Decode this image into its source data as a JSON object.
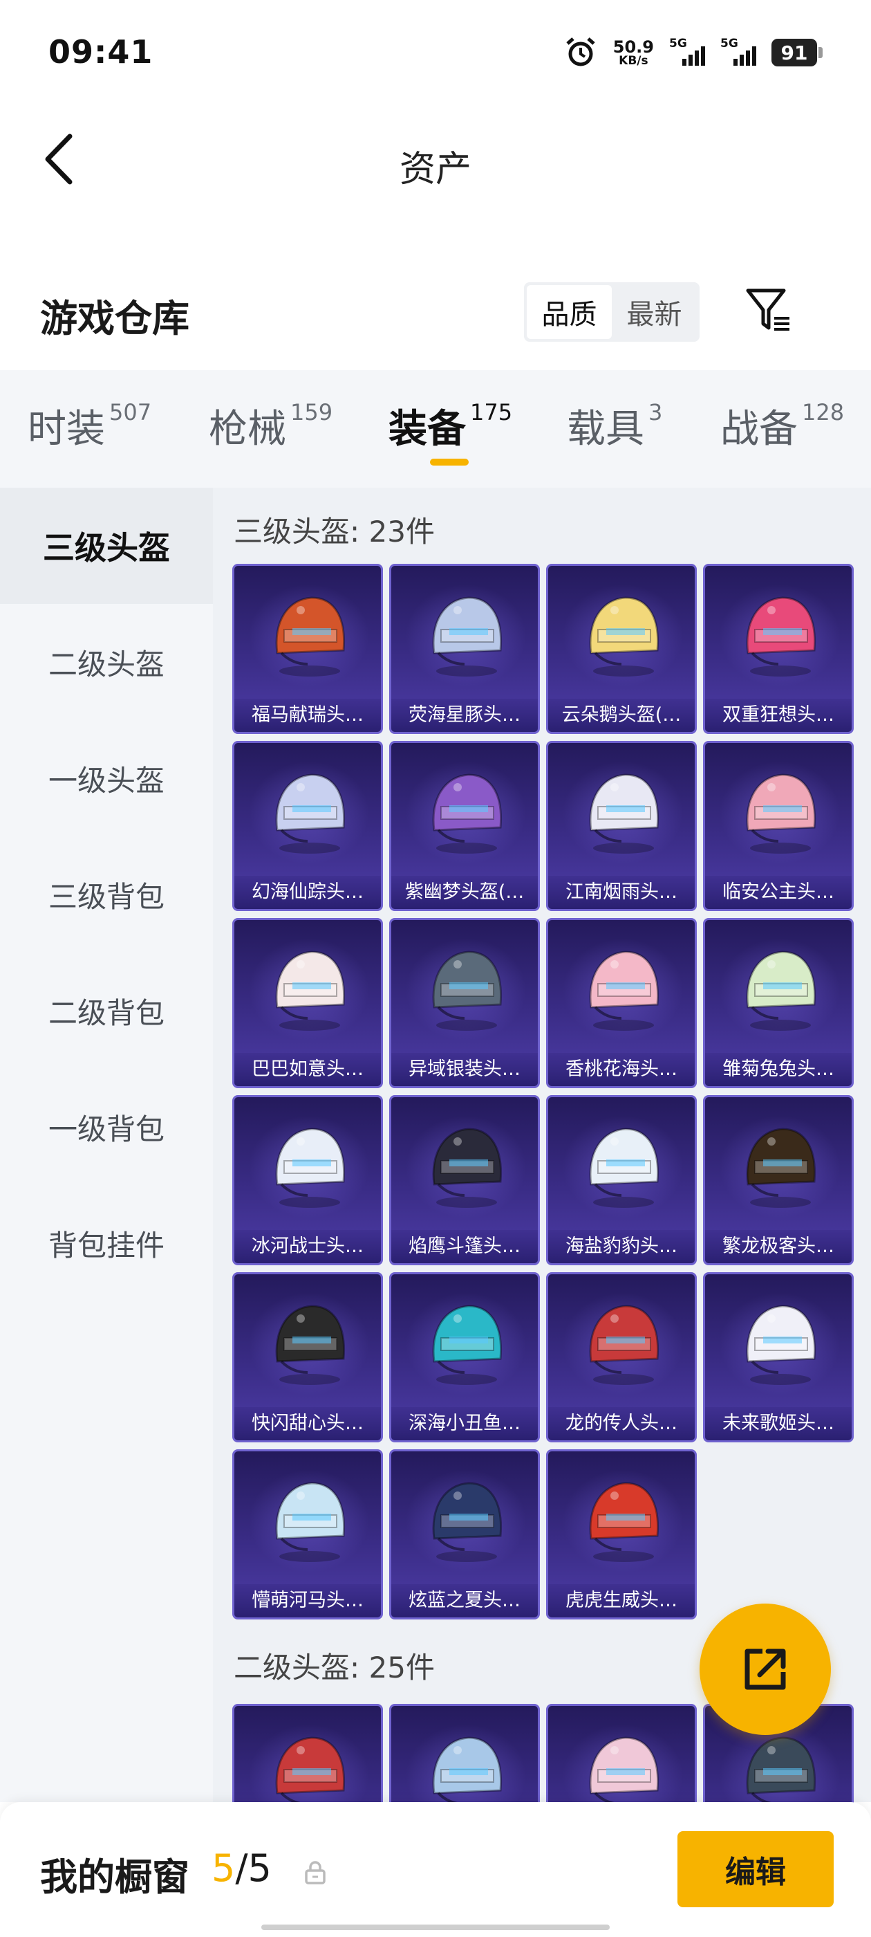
{
  "status_bar": {
    "time": "09:41",
    "net_speed_value": "50.9",
    "net_speed_unit": "KB/s",
    "signal1": "5G",
    "signal2": "5G",
    "battery": "91"
  },
  "nav": {
    "title": "资产",
    "back_icon": "chevron-left-icon"
  },
  "warehouse": {
    "title": "游戏仓库",
    "sort_options": [
      "品质",
      "最新"
    ],
    "active_sort": "品质",
    "filter_icon": "filter-icon"
  },
  "tabs": [
    {
      "name": "时装",
      "count": "507"
    },
    {
      "name": "枪械",
      "count": "159"
    },
    {
      "name": "装备",
      "count": "175"
    },
    {
      "name": "载具",
      "count": "3"
    },
    {
      "name": "战备",
      "count": "128"
    }
  ],
  "active_tab": "装备",
  "side_menu": [
    "三级头盔",
    "二级头盔",
    "一级头盔",
    "三级背包",
    "二级背包",
    "一级背包",
    "背包挂件"
  ],
  "active_side": "三级头盔",
  "sections": [
    {
      "title": "三级头盔: 23件",
      "items": [
        "福马献瑞头…",
        "荧海星豚头…",
        "云朵鹅头盔(…",
        "双重狂想头…",
        "幻海仙踪头…",
        "紫幽梦头盔(…",
        "江南烟雨头…",
        "临安公主头…",
        "巴巴如意头…",
        "异域银装头…",
        "香桃花海头…",
        "雏菊兔兔头…",
        "冰河战士头…",
        "焰鹰斗篷头…",
        "海盐豹豹头…",
        "繁龙极客头…",
        "快闪甜心头…",
        "深海小丑鱼…",
        "龙的传人头…",
        "未来歌姬头…",
        "懵萌河马头…",
        "炫蓝之夏头…",
        "虎虎生威头…"
      ]
    },
    {
      "title": "二级头盔: 25件",
      "items": [
        "",
        "",
        "",
        ""
      ]
    }
  ],
  "helmet_colors": [
    "#d4552a",
    "#b8c8e8",
    "#f2d87a",
    "#e84a7a",
    "#c8d0f0",
    "#8a5ac8",
    "#e8e8f4",
    "#f0a8b8",
    "#f4e8e8",
    "#5a6a7a",
    "#f4b8c8",
    "#d8ecc8",
    "#e8eef8",
    "#2a2a3a",
    "#e8f0f8",
    "#3a2a1a",
    "#2a2a2a",
    "#2ab8c8",
    "#c83a3a",
    "#f0f0f8",
    "#c8e4f4",
    "#2a3a6a",
    "#d83a2a",
    "#c83a3a",
    "#a8c8e8",
    "#f0c8d8",
    "#3a4a5a"
  ],
  "fab_icon": "share-icon",
  "bottom_bar": {
    "label": "我的橱窗",
    "count_current": "5",
    "count_total": "/5",
    "lock_icon": "lock-icon",
    "edit_label": "编辑"
  }
}
